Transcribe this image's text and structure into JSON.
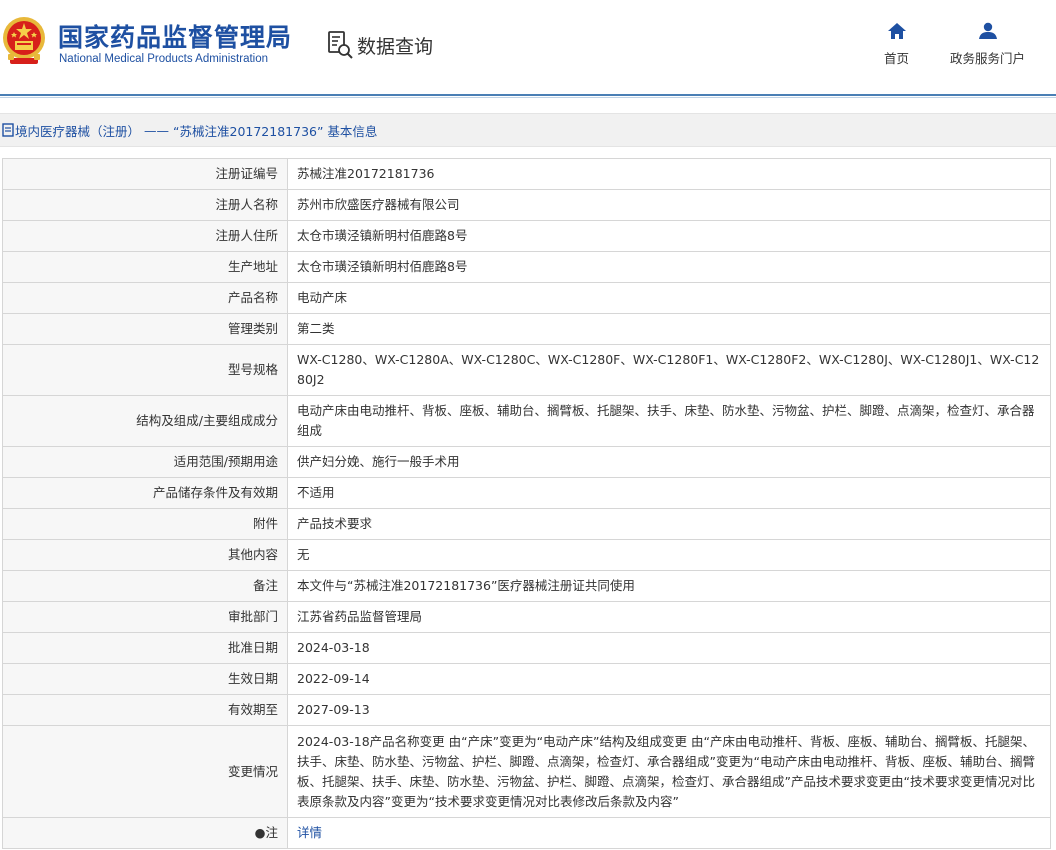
{
  "header": {
    "brand_cn": "国家药品监督管理局",
    "brand_en": "National Medical Products Administration",
    "query_label": "数据查询",
    "nav": [
      {
        "label": "首页",
        "icon": "home-icon"
      },
      {
        "label": "政务服务门户",
        "icon": "user-icon"
      }
    ],
    "colors": {
      "brand": "#1e50a2",
      "divider": "#4a7fb5"
    }
  },
  "breadcrumb": {
    "link": "境内医疗器械（注册）",
    "separator": "——",
    "title": "“苏械注准20172181736” 基本信息"
  },
  "rows": [
    {
      "key": "注册证编号",
      "value": "苏械注准20172181736"
    },
    {
      "key": "注册人名称",
      "value": "苏州市欣盛医疗器械有限公司"
    },
    {
      "key": "注册人住所",
      "value": "太仓市璜泾镇新明村佰鹿路8号"
    },
    {
      "key": "生产地址",
      "value": "太仓市璜泾镇新明村佰鹿路8号"
    },
    {
      "key": "产品名称",
      "value": "电动产床"
    },
    {
      "key": "管理类别",
      "value": "第二类"
    },
    {
      "key": "型号规格",
      "value": "WX-C1280、WX-C1280A、WX-C1280C、WX-C1280F、WX-C1280F1、WX-C1280F2、WX-C1280J、WX-C1280J1、WX-C1280J2"
    },
    {
      "key": "结构及组成/主要组成成分",
      "value": "电动产床由电动推杆、背板、座板、辅助台、搁臂板、托腿架、扶手、床垫、防水垫、污物盆、护栏、脚蹬、点滴架，检查灯、承合器组成"
    },
    {
      "key": "适用范围/预期用途",
      "value": "供产妇分娩、施行一般手术用"
    },
    {
      "key": "产品储存条件及有效期",
      "value": "不适用"
    },
    {
      "key": "附件",
      "value": "产品技术要求"
    },
    {
      "key": "其他内容",
      "value": "无"
    },
    {
      "key": "备注",
      "value": "本文件与“苏械注准20172181736”医疗器械注册证共同使用"
    },
    {
      "key": "审批部门",
      "value": "江苏省药品监督管理局"
    },
    {
      "key": "批准日期",
      "value": "2024-03-18"
    },
    {
      "key": "生效日期",
      "value": "2022-09-14"
    },
    {
      "key": "有效期至",
      "value": "2027-09-13"
    },
    {
      "key": "变更情况",
      "value": "2024-03-18产品名称变更 由“产床”变更为“电动产床”结构及组成变更 由“产床由电动推杆、背板、座板、辅助台、搁臂板、托腿架、扶手、床垫、防水垫、污物盆、护栏、脚蹬、点滴架，检查灯、承合器组成”变更为“电动产床由电动推杆、背板、座板、辅助台、搁臂板、托腿架、扶手、床垫、防水垫、污物盆、护栏、脚蹬、点滴架，检查灯、承合器组成”产品技术要求变更由“技术要求变更情况对比表原条款及内容”变更为“技术要求变更情况对比表修改后条款及内容”"
    },
    {
      "key": "注",
      "value": "详情"
    }
  ]
}
